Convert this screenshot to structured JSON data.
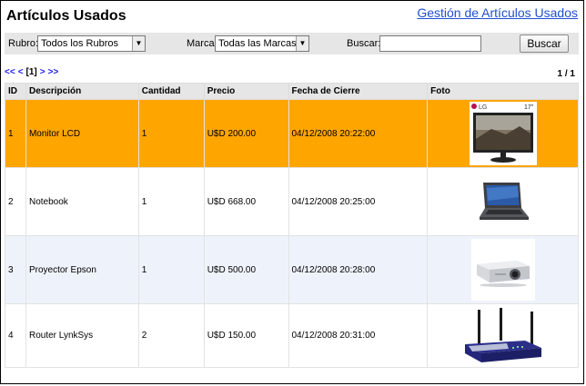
{
  "header": {
    "title": "Artículos Usados",
    "admin_link": "Gestión de Artículos Usados"
  },
  "filters": {
    "rubro_label": "Rubro:",
    "rubro_value": "Todos los Rubros",
    "marca_label": "Marca:",
    "marca_value": "Todas las Marcas",
    "buscar_label": "Buscar:",
    "search_value": "",
    "search_button": "Buscar"
  },
  "pager": {
    "first": "<<",
    "prev": "<",
    "current": "[1]",
    "next": ">",
    "last": ">>",
    "page_count": "1 / 1"
  },
  "table": {
    "columns": [
      "ID",
      "Descripción",
      "Cantidad",
      "Precio",
      "Fecha de Cierre",
      "Foto"
    ],
    "rows": [
      {
        "id": "1",
        "descripcion": "Monitor LCD",
        "cantidad": "1",
        "precio": "U$D 200.00",
        "fecha": "04/12/2008 20:22:00",
        "foto": "lcd-monitor-photo",
        "brand": "LG",
        "size": "17\""
      },
      {
        "id": "2",
        "descripcion": "Notebook",
        "cantidad": "1",
        "precio": "U$D 668.00",
        "fecha": "04/12/2008 20:25:00",
        "foto": "notebook-photo"
      },
      {
        "id": "3",
        "descripcion": "Proyector Epson",
        "cantidad": "1",
        "precio": "U$D 500.00",
        "fecha": "04/12/2008 20:28:00",
        "foto": "projector-photo"
      },
      {
        "id": "4",
        "descripcion": "Router LynkSys",
        "cantidad": "2",
        "precio": "U$D 150.00",
        "fecha": "04/12/2008 20:31:00",
        "foto": "router-photo"
      }
    ]
  },
  "colors": {
    "selected_row": "#ffa500",
    "alt_row": "#eef3fb",
    "header_bg": "#e6e6e6",
    "link": "#1f4fd1"
  }
}
